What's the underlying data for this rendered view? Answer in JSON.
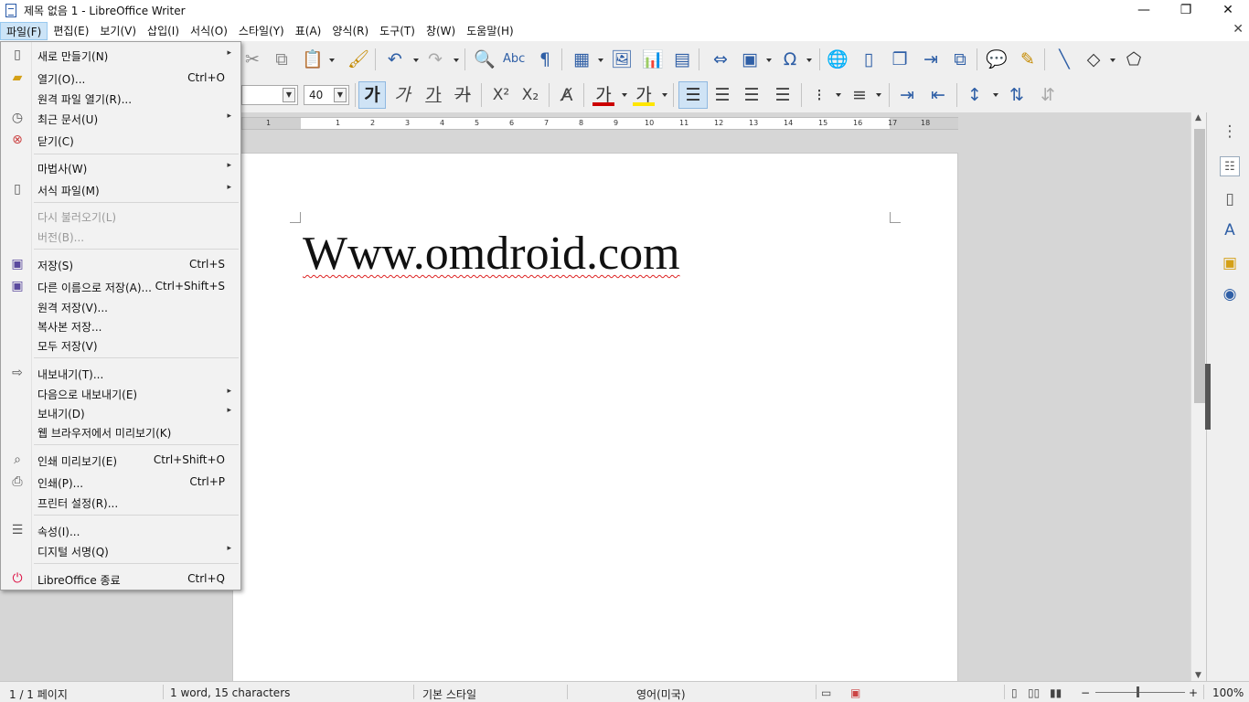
{
  "window": {
    "title": "제목 없음 1 - LibreOffice Writer",
    "minimize": "—",
    "maximize": "❐",
    "close": "✕",
    "doc_close": "✕"
  },
  "menubar": [
    {
      "label": "파일(F)"
    },
    {
      "label": "편집(E)"
    },
    {
      "label": "보기(V)"
    },
    {
      "label": "삽입(I)"
    },
    {
      "label": "서식(O)"
    },
    {
      "label": "스타일(Y)"
    },
    {
      "label": "표(A)"
    },
    {
      "label": "양식(R)"
    },
    {
      "label": "도구(T)"
    },
    {
      "label": "창(W)"
    },
    {
      "label": "도움말(H)"
    }
  ],
  "formatting": {
    "font_size": "40",
    "bold": "가",
    "italic": "가",
    "underline": "가",
    "strikethrough": "가",
    "superscript": "X²",
    "subscript": "X₂",
    "font_color": "가",
    "highlight_color": "가"
  },
  "ruler_numbers": [
    "1",
    "1",
    "2",
    "3",
    "4",
    "5",
    "6",
    "7",
    "8",
    "9",
    "10",
    "11",
    "12",
    "13",
    "14",
    "15",
    "16",
    "17",
    "18"
  ],
  "document": {
    "text": "Www.omdroid.com"
  },
  "file_menu": {
    "items": [
      {
        "label": "새로 만들기(N)",
        "shortcut": "",
        "submenu": true,
        "icon": "new-document-icon"
      },
      {
        "label": "열기(O)...",
        "shortcut": "Ctrl+O",
        "submenu": false,
        "icon": "open-folder-icon"
      },
      {
        "label": "원격 파일 열기(R)...",
        "shortcut": "",
        "submenu": false,
        "icon": ""
      },
      {
        "label": "최근 문서(U)",
        "shortcut": "",
        "submenu": true,
        "icon": "clock-icon"
      },
      {
        "label": "닫기(C)",
        "shortcut": "",
        "submenu": false,
        "icon": "close-document-icon"
      },
      {
        "label": "마법사(W)",
        "shortcut": "",
        "submenu": true,
        "icon": ""
      },
      {
        "label": "서식 파일(M)",
        "shortcut": "",
        "submenu": true,
        "icon": "template-icon"
      },
      {
        "label": "다시 불러오기(L)",
        "shortcut": "",
        "submenu": false,
        "icon": "",
        "disabled": true
      },
      {
        "label": "버전(B)...",
        "shortcut": "",
        "submenu": false,
        "icon": "",
        "disabled": true
      },
      {
        "label": "저장(S)",
        "shortcut": "Ctrl+S",
        "submenu": false,
        "icon": "save-icon"
      },
      {
        "label": "다른 이름으로 저장(A)...",
        "shortcut": "Ctrl+Shift+S",
        "submenu": false,
        "icon": "save-as-icon"
      },
      {
        "label": "원격 저장(V)...",
        "shortcut": "",
        "submenu": false,
        "icon": ""
      },
      {
        "label": "복사본 저장...",
        "shortcut": "",
        "submenu": false,
        "icon": ""
      },
      {
        "label": "모두 저장(V)",
        "shortcut": "",
        "submenu": false,
        "icon": ""
      },
      {
        "label": "내보내기(T)...",
        "shortcut": "",
        "submenu": false,
        "icon": "export-icon"
      },
      {
        "label": "다음으로 내보내기(E)",
        "shortcut": "",
        "submenu": true,
        "icon": ""
      },
      {
        "label": "보내기(D)",
        "shortcut": "",
        "submenu": true,
        "icon": ""
      },
      {
        "label": "웹 브라우저에서 미리보기(K)",
        "shortcut": "",
        "submenu": false,
        "icon": ""
      },
      {
        "label": "인쇄 미리보기(E)",
        "shortcut": "Ctrl+Shift+O",
        "submenu": false,
        "icon": "print-preview-icon"
      },
      {
        "label": "인쇄(P)...",
        "shortcut": "Ctrl+P",
        "submenu": false,
        "icon": "printer-icon"
      },
      {
        "label": "프린터 설정(R)...",
        "shortcut": "",
        "submenu": false,
        "icon": ""
      },
      {
        "label": "속성(I)...",
        "shortcut": "",
        "submenu": false,
        "icon": "properties-icon"
      },
      {
        "label": "디지털 서명(Q)",
        "shortcut": "",
        "submenu": true,
        "icon": ""
      },
      {
        "label": "LibreOffice 종료",
        "shortcut": "Ctrl+Q",
        "submenu": false,
        "icon": "power-icon"
      }
    ]
  },
  "statusbar": {
    "page": "1 / 1 페이지",
    "words": "1 word, 15 characters",
    "style": "기본 스타일",
    "language": "영어(미국)",
    "zoom": "100%",
    "zoom_minus": "−",
    "zoom_plus": "+"
  },
  "colors": {
    "accent": "#2f5fa6",
    "menu_active_bg": "#cce4f7",
    "spell_underline": "#d22222"
  }
}
